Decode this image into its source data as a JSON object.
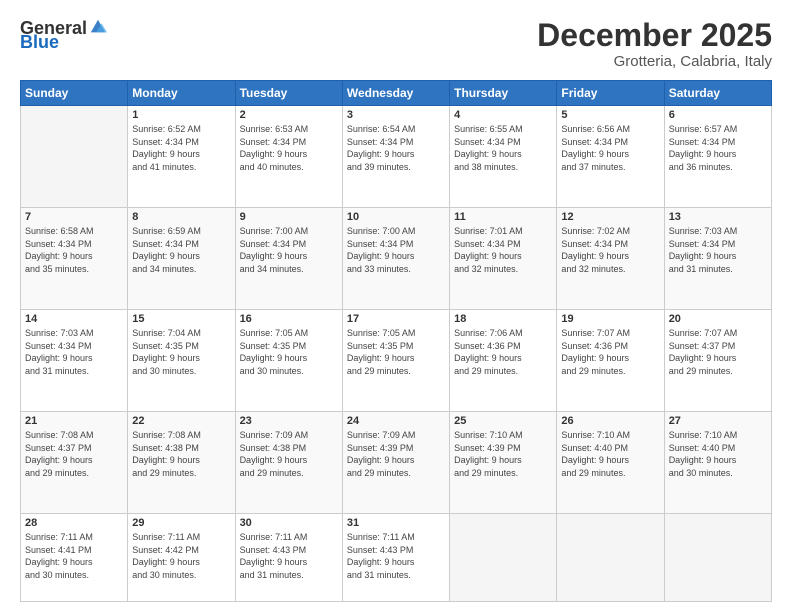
{
  "logo": {
    "general": "General",
    "blue": "Blue"
  },
  "header": {
    "month": "December 2025",
    "location": "Grotteria, Calabria, Italy"
  },
  "weekdays": [
    "Sunday",
    "Monday",
    "Tuesday",
    "Wednesday",
    "Thursday",
    "Friday",
    "Saturday"
  ],
  "weeks": [
    [
      {
        "day": "",
        "info": ""
      },
      {
        "day": "1",
        "info": "Sunrise: 6:52 AM\nSunset: 4:34 PM\nDaylight: 9 hours\nand 41 minutes."
      },
      {
        "day": "2",
        "info": "Sunrise: 6:53 AM\nSunset: 4:34 PM\nDaylight: 9 hours\nand 40 minutes."
      },
      {
        "day": "3",
        "info": "Sunrise: 6:54 AM\nSunset: 4:34 PM\nDaylight: 9 hours\nand 39 minutes."
      },
      {
        "day": "4",
        "info": "Sunrise: 6:55 AM\nSunset: 4:34 PM\nDaylight: 9 hours\nand 38 minutes."
      },
      {
        "day": "5",
        "info": "Sunrise: 6:56 AM\nSunset: 4:34 PM\nDaylight: 9 hours\nand 37 minutes."
      },
      {
        "day": "6",
        "info": "Sunrise: 6:57 AM\nSunset: 4:34 PM\nDaylight: 9 hours\nand 36 minutes."
      }
    ],
    [
      {
        "day": "7",
        "info": "Sunrise: 6:58 AM\nSunset: 4:34 PM\nDaylight: 9 hours\nand 35 minutes."
      },
      {
        "day": "8",
        "info": "Sunrise: 6:59 AM\nSunset: 4:34 PM\nDaylight: 9 hours\nand 34 minutes."
      },
      {
        "day": "9",
        "info": "Sunrise: 7:00 AM\nSunset: 4:34 PM\nDaylight: 9 hours\nand 34 minutes."
      },
      {
        "day": "10",
        "info": "Sunrise: 7:00 AM\nSunset: 4:34 PM\nDaylight: 9 hours\nand 33 minutes."
      },
      {
        "day": "11",
        "info": "Sunrise: 7:01 AM\nSunset: 4:34 PM\nDaylight: 9 hours\nand 32 minutes."
      },
      {
        "day": "12",
        "info": "Sunrise: 7:02 AM\nSunset: 4:34 PM\nDaylight: 9 hours\nand 32 minutes."
      },
      {
        "day": "13",
        "info": "Sunrise: 7:03 AM\nSunset: 4:34 PM\nDaylight: 9 hours\nand 31 minutes."
      }
    ],
    [
      {
        "day": "14",
        "info": "Sunrise: 7:03 AM\nSunset: 4:34 PM\nDaylight: 9 hours\nand 31 minutes."
      },
      {
        "day": "15",
        "info": "Sunrise: 7:04 AM\nSunset: 4:35 PM\nDaylight: 9 hours\nand 30 minutes."
      },
      {
        "day": "16",
        "info": "Sunrise: 7:05 AM\nSunset: 4:35 PM\nDaylight: 9 hours\nand 30 minutes."
      },
      {
        "day": "17",
        "info": "Sunrise: 7:05 AM\nSunset: 4:35 PM\nDaylight: 9 hours\nand 29 minutes."
      },
      {
        "day": "18",
        "info": "Sunrise: 7:06 AM\nSunset: 4:36 PM\nDaylight: 9 hours\nand 29 minutes."
      },
      {
        "day": "19",
        "info": "Sunrise: 7:07 AM\nSunset: 4:36 PM\nDaylight: 9 hours\nand 29 minutes."
      },
      {
        "day": "20",
        "info": "Sunrise: 7:07 AM\nSunset: 4:37 PM\nDaylight: 9 hours\nand 29 minutes."
      }
    ],
    [
      {
        "day": "21",
        "info": "Sunrise: 7:08 AM\nSunset: 4:37 PM\nDaylight: 9 hours\nand 29 minutes."
      },
      {
        "day": "22",
        "info": "Sunrise: 7:08 AM\nSunset: 4:38 PM\nDaylight: 9 hours\nand 29 minutes."
      },
      {
        "day": "23",
        "info": "Sunrise: 7:09 AM\nSunset: 4:38 PM\nDaylight: 9 hours\nand 29 minutes."
      },
      {
        "day": "24",
        "info": "Sunrise: 7:09 AM\nSunset: 4:39 PM\nDaylight: 9 hours\nand 29 minutes."
      },
      {
        "day": "25",
        "info": "Sunrise: 7:10 AM\nSunset: 4:39 PM\nDaylight: 9 hours\nand 29 minutes."
      },
      {
        "day": "26",
        "info": "Sunrise: 7:10 AM\nSunset: 4:40 PM\nDaylight: 9 hours\nand 29 minutes."
      },
      {
        "day": "27",
        "info": "Sunrise: 7:10 AM\nSunset: 4:40 PM\nDaylight: 9 hours\nand 30 minutes."
      }
    ],
    [
      {
        "day": "28",
        "info": "Sunrise: 7:11 AM\nSunset: 4:41 PM\nDaylight: 9 hours\nand 30 minutes."
      },
      {
        "day": "29",
        "info": "Sunrise: 7:11 AM\nSunset: 4:42 PM\nDaylight: 9 hours\nand 30 minutes."
      },
      {
        "day": "30",
        "info": "Sunrise: 7:11 AM\nSunset: 4:43 PM\nDaylight: 9 hours\nand 31 minutes."
      },
      {
        "day": "31",
        "info": "Sunrise: 7:11 AM\nSunset: 4:43 PM\nDaylight: 9 hours\nand 31 minutes."
      },
      {
        "day": "",
        "info": ""
      },
      {
        "day": "",
        "info": ""
      },
      {
        "day": "",
        "info": ""
      }
    ]
  ]
}
